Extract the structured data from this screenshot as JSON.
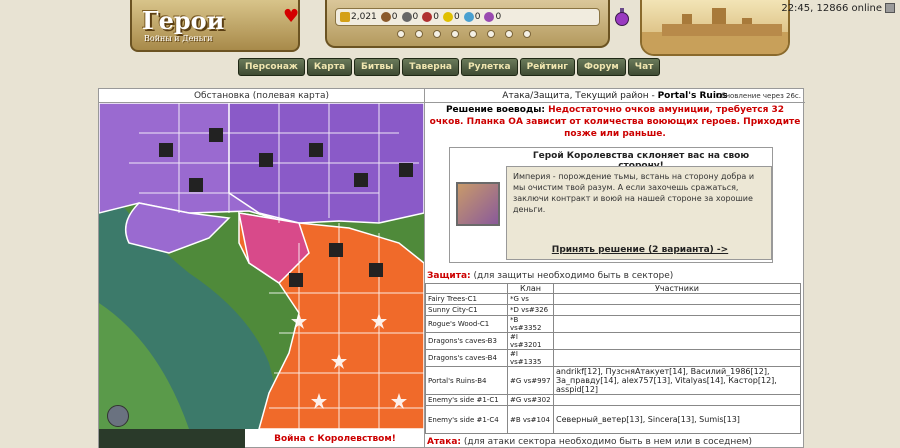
{
  "header": {
    "logo": "Герои",
    "logo_sub": "Войны и Деньги",
    "resources": [
      {
        "name": "gold-icon",
        "value": "2,021",
        "color": "#d4a017"
      },
      {
        "name": "wood-icon",
        "value": "0",
        "color": "#8b5a2b"
      },
      {
        "name": "ore-icon",
        "value": "0",
        "color": "#666666"
      },
      {
        "name": "mercury-icon",
        "value": "0",
        "color": "#b03030"
      },
      {
        "name": "sulfur-icon",
        "value": "0",
        "color": "#e0c000"
      },
      {
        "name": "crystal-icon",
        "value": "0",
        "color": "#4aa0d0"
      },
      {
        "name": "gem-icon",
        "value": "0",
        "color": "#9a4ab0"
      }
    ],
    "time_online": "22:45, 12866 online",
    "nav": [
      "Персонаж",
      "Карта",
      "Битвы",
      "Таверна",
      "Рулетка",
      "Рейтинг",
      "Форум",
      "Чат"
    ]
  },
  "left": {
    "title": "Обстановка (полевая карта)",
    "war_label": "Война с Королевством!"
  },
  "right": {
    "title_prefix": "Атака/Защита, Текущий район - ",
    "title_district": "Portal's Ruins",
    "refresh": "Обновление через 26с.",
    "decision_label": "Решение воеводы: ",
    "decision_text": "Недостаточно очков амуниции, требуется 32 очков. Планка ОА зависит от количества воюющих героев. Приходите позже или раньше.",
    "offer_title": "Герой Королевства склоняет вас на свою сторону!",
    "offer_text": "Империя - порождение тьмы, встань на сторону добра и мы очистим твой разум. А если захочешь сражаться, заключи контракт и воюй на нашей стороне за хорошие деньги.",
    "offer_link": "Принять решение (2 варианта) ->",
    "defense_label": "Защита:",
    "defense_note": " (для защиты необходимо быть в секторе)",
    "col_clan": "Клан",
    "col_participants": "Участники",
    "rows": [
      {
        "sector": "Fairy Trees-C1",
        "clan": "*G vs",
        "participants": ""
      },
      {
        "sector": "Sunny City-C1",
        "clan": "*D vs#326",
        "participants": ""
      },
      {
        "sector": "Rogue's Wood-C1",
        "clan": "*B vs#3352",
        "participants": ""
      },
      {
        "sector": "Dragons's caves-B3",
        "clan": "#I vs#3201",
        "participants": ""
      },
      {
        "sector": "Dragons's caves-B4",
        "clan": "#I vs#1335",
        "participants": ""
      },
      {
        "sector": "Portal's Ruins-B4",
        "clan": "#G vs#997",
        "participants": "andrikf[12], ПузсняАтакует[14], Василий_1986[12], За_правду[14], alex757[13], Vitalyas[14], Кастор[12], asspid[12]"
      },
      {
        "sector": "Enemy's side #1-C1",
        "clan": "#G vs#302",
        "participants": ""
      },
      {
        "sector": "Enemy's side #1-C4",
        "clan": "#B vs#104",
        "participants": "Северный_ветер[13], Sincera[13], Sumis[13]"
      }
    ],
    "attack_label": "Атака:",
    "attack_note": " (для атаки сектора необходимо быть в нем или в соседнем)"
  }
}
